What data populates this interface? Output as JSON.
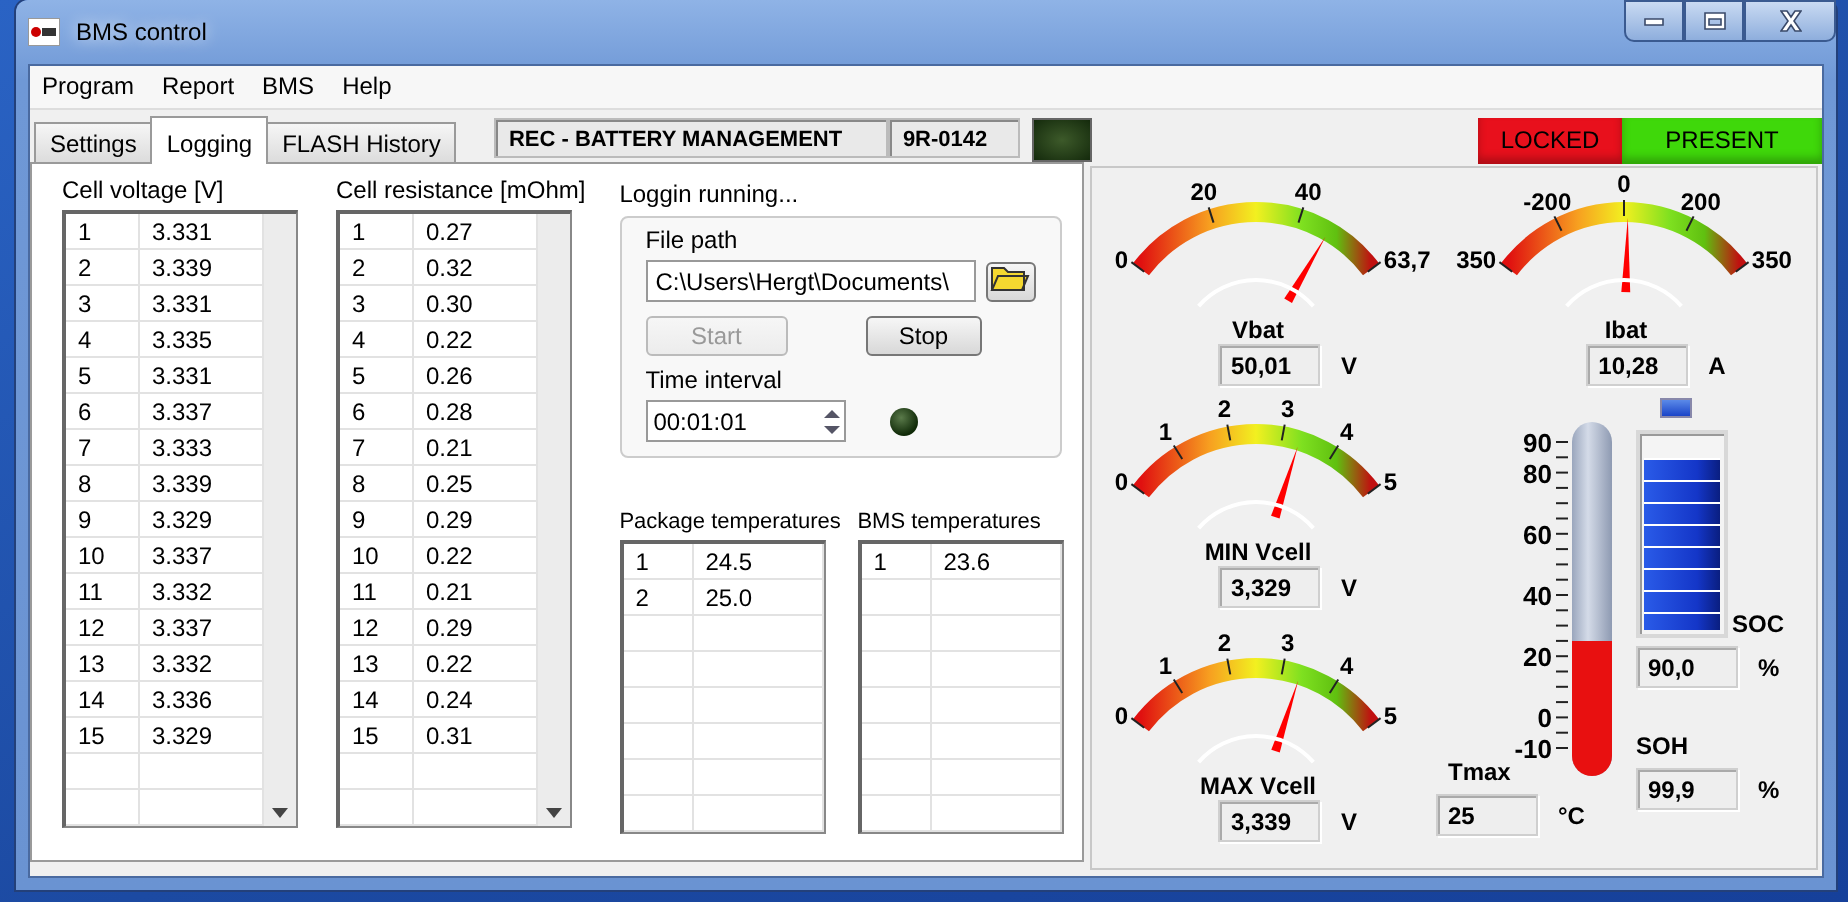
{
  "window": {
    "title": "BMS control"
  },
  "menu": [
    "Program",
    "Report",
    "BMS",
    "Help"
  ],
  "tabs": [
    {
      "label": "Settings",
      "selected": false
    },
    {
      "label": "Logging",
      "selected": true
    },
    {
      "label": "FLASH History",
      "selected": false
    }
  ],
  "header": {
    "title": "REC - BATTERY MANAGEMENT",
    "serial": "9R-0142",
    "led_on": false
  },
  "indicators": [
    {
      "label": "LOCKED",
      "color": "#e8101c"
    },
    {
      "label": "PRESENT",
      "color": "#3fd80a"
    }
  ],
  "cell_voltage": {
    "title": "Cell voltage [V]",
    "rows": [
      [
        "1",
        "3.331"
      ],
      [
        "2",
        "3.339"
      ],
      [
        "3",
        "3.331"
      ],
      [
        "4",
        "3.335"
      ],
      [
        "5",
        "3.331"
      ],
      [
        "6",
        "3.337"
      ],
      [
        "7",
        "3.333"
      ],
      [
        "8",
        "3.339"
      ],
      [
        "9",
        "3.329"
      ],
      [
        "10",
        "3.337"
      ],
      [
        "11",
        "3.332"
      ],
      [
        "12",
        "3.337"
      ],
      [
        "13",
        "3.332"
      ],
      [
        "14",
        "3.336"
      ],
      [
        "15",
        "3.329"
      ]
    ]
  },
  "cell_resistance": {
    "title": "Cell resistance [mOhm]",
    "rows": [
      [
        "1",
        "0.27"
      ],
      [
        "2",
        "0.32"
      ],
      [
        "3",
        "0.30"
      ],
      [
        "4",
        "0.22"
      ],
      [
        "5",
        "0.26"
      ],
      [
        "6",
        "0.28"
      ],
      [
        "7",
        "0.21"
      ],
      [
        "8",
        "0.25"
      ],
      [
        "9",
        "0.29"
      ],
      [
        "10",
        "0.22"
      ],
      [
        "11",
        "0.21"
      ],
      [
        "12",
        "0.29"
      ],
      [
        "13",
        "0.22"
      ],
      [
        "14",
        "0.24"
      ],
      [
        "15",
        "0.31"
      ]
    ]
  },
  "logging": {
    "status": "Loggin running...",
    "file_path_label": "File path",
    "file_path": "C:\\Users\\Hergt\\Documents\\",
    "start": {
      "label": "Start",
      "disabled": true
    },
    "stop": {
      "label": "Stop",
      "disabled": false
    },
    "interval_label": "Time interval",
    "interval": "00:01:01",
    "led_on": false
  },
  "package_temperatures": {
    "title": "Package temperatures",
    "rows": [
      [
        "1",
        "24.5"
      ],
      [
        "2",
        "25.0"
      ]
    ]
  },
  "bms_temperatures": {
    "title": "BMS temperatures",
    "rows": [
      [
        "1",
        "23.6"
      ]
    ]
  },
  "gauges": [
    {
      "name": "Vbat",
      "ticks": [
        "0",
        "20",
        "40",
        "63,7"
      ],
      "level": 0.785,
      "value": "50,01",
      "unit": "V"
    },
    {
      "name": "Ibat",
      "ticks": [
        "350",
        "-200",
        "0",
        "200",
        "350"
      ],
      "level": 0.515,
      "value": "10,28",
      "unit": "A"
    },
    {
      "name": "MIN Vcell",
      "ticks": [
        "0",
        "1",
        "2",
        "3",
        "4",
        "5"
      ],
      "level": 0.666,
      "value": "3,329",
      "unit": "V"
    },
    {
      "name": "MAX Vcell",
      "ticks": [
        "0",
        "1",
        "2",
        "3",
        "4",
        "5"
      ],
      "level": 0.668,
      "value": "3,339",
      "unit": "V"
    }
  ],
  "thermometer": {
    "label": "Tmax",
    "ticks": [
      "90",
      "80",
      "60",
      "40",
      "20",
      "0",
      "-10"
    ],
    "level": 0.35,
    "value": "25",
    "unit": "°C"
  },
  "soc": {
    "label": "SOC",
    "level": 0.9,
    "value": "90,0",
    "unit": "%"
  },
  "soh": {
    "label": "SOH",
    "value": "99,9",
    "unit": "%"
  }
}
